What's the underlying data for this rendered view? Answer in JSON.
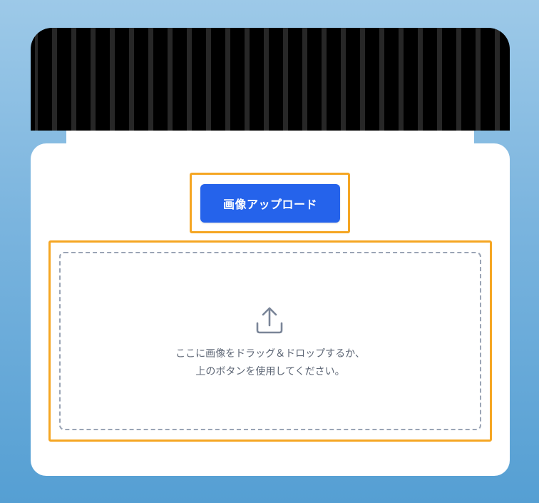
{
  "upload": {
    "button_label": "画像アップロード",
    "accent_color": "#2563eb",
    "highlight_color": "#f5a623"
  },
  "dropzone": {
    "icon": "upload-icon",
    "line1": "ここに画像をドラッグ＆ドロップするか、",
    "line2": "上のボタンを使用してください。"
  }
}
